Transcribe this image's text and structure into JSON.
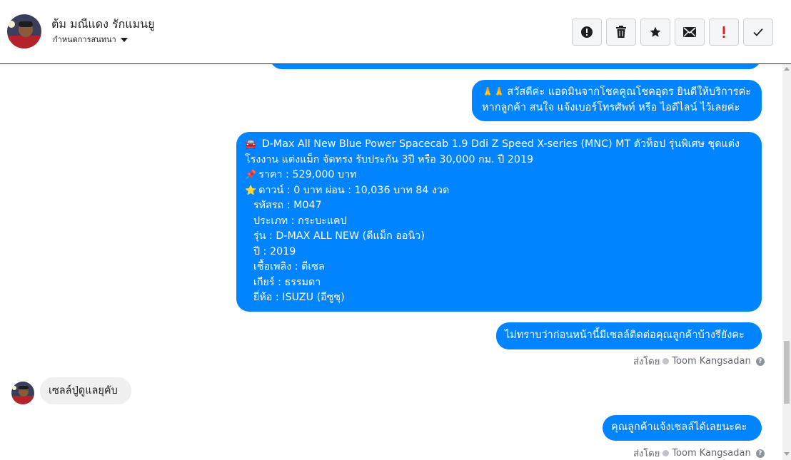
{
  "header": {
    "contact_name": "ต้ม มณีแดง รักแมนยู",
    "subtitle": "กำหนดการสนทนา"
  },
  "toolbar": {
    "buttons": [
      {
        "icon": "alert-circle-icon",
        "label": "!"
      },
      {
        "icon": "trash-icon"
      },
      {
        "icon": "star-icon"
      },
      {
        "icon": "envelope-icon"
      },
      {
        "icon": "exclamation-icon",
        "label": "!"
      },
      {
        "icon": "checkmark-icon"
      }
    ]
  },
  "messages": {
    "greeting": {
      "emoji": "🙏🙏",
      "lines": [
        "สวัสดีค่ะ แอดมินจากโชคคูณโชคอุดร ยินดีให้บริการค่ะ",
        "หากลูกค้า สนใจ แจ้งเบอร์โทรศัพท์ หรือ ไอดีไลน์  ไว้เลยค่ะ"
      ]
    },
    "listing": {
      "car_emoji": "🚘",
      "pin_emoji": "📌",
      "star_emoji": "⭐",
      "line1": "D-Max All New Blue Power Spacecab 1.9 Ddi Z Speed X-series (MNC) MT ตัวท็อป รุ่นพิเศษ ชุดแต่ง",
      "line2": "โรงงาน แต่งแม็ก จัดทรง รับประกัน 3ปี หรือ 30,000 กม. ปี 2019",
      "price": "ราคา : 529,000 บาท",
      "down": "ดาวน์ : 0 บาท ผ่อน : 10,036 บาท 84 งวด",
      "code": "รหัสรถ : M047",
      "type": "ประเภท : กระบะแคป",
      "model": "รุ่น : D-MAX ALL NEW (ดีแม็ก ออนิว)",
      "year": "ปี : 2019",
      "fuel": "เชื้อเพลิง : ดีเซล",
      "gear": "เกียร์ : ธรรมดา",
      "brand": "ยี่ห้อ : ISUZU (อีซูซุ)"
    },
    "question": "ไม่ทราบว่าก่อนหน้านี้มีเซลล์ติดต่อคุณลูกค้าบ้างรึยังคะ",
    "sent_by_prefix": "ส่งโดย",
    "sent_by_name": "Toom Kangsadan",
    "incoming": "เซลล์ปู่ดูแลยุคับ",
    "reply": "คุณลูกค้าแจ้งเซลล์ได้เลยนะคะ",
    "sent_by_prefix_2": "ส่งโดย",
    "sent_by_name_2": "Toom Kangsadan"
  },
  "colors": {
    "outgoing_bubble": "#0084ff",
    "incoming_bubble": "#f1f0f0"
  }
}
